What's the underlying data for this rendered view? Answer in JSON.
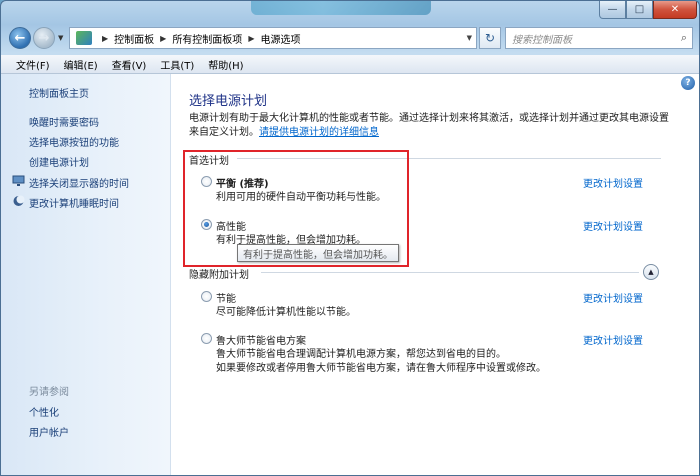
{
  "window": {
    "controls": {
      "minimize": "—",
      "maximize": "□",
      "close": "✕"
    }
  },
  "address": {
    "crumbs": [
      "控制面板",
      "所有控制面板项",
      "电源选项"
    ],
    "search_placeholder": "搜索控制面板"
  },
  "menu": [
    "文件(F)",
    "编辑(E)",
    "查看(V)",
    "工具(T)",
    "帮助(H)"
  ],
  "sidebar": {
    "home": "控制面板主页",
    "links": [
      "唤醒时需要密码",
      "选择电源按钮的功能",
      "创建电源计划",
      "选择关闭显示器的时间",
      "更改计算机睡眠时间"
    ],
    "see_also": "另请参阅",
    "see_also_links": [
      "个性化",
      "用户帐户"
    ]
  },
  "main": {
    "title": "选择电源计划",
    "desc_line1": "电源计划有助于最大化计算机的性能或者节能。通过选择计划来将其激活，或选择计划并通过更改其电源设置",
    "desc_line2_prefix": "来自定义计划。",
    "desc_link": "请提供电源计划的详细信息",
    "preferred_label": "首选计划",
    "hidden_label": "隐藏附加计划",
    "change_link": "更改计划设置",
    "plans": [
      {
        "name": "平衡 (推荐)",
        "desc": "利用可用的硬件自动平衡功耗与性能。",
        "selected": false
      },
      {
        "name": "高性能",
        "desc": "有利于提高性能，但会增加功耗。",
        "selected": true
      },
      {
        "name": "节能",
        "desc": "尽可能降低计算机性能以节能。",
        "selected": false
      },
      {
        "name": "鲁大师节能省电方案",
        "desc": "鲁大师节能省电合理调配计算机电源方案，帮您达到省电的目的。",
        "desc2": "如果要修改或者停用鲁大师节能省电方案，请在鲁大师程序中设置或修改。",
        "selected": false
      }
    ],
    "tooltip": "有利于提高性能，但会增加功耗。",
    "help": "?"
  },
  "colors": {
    "accent_title": "#1e3287",
    "link": "#0066cc",
    "highlight": "#e0242a"
  }
}
